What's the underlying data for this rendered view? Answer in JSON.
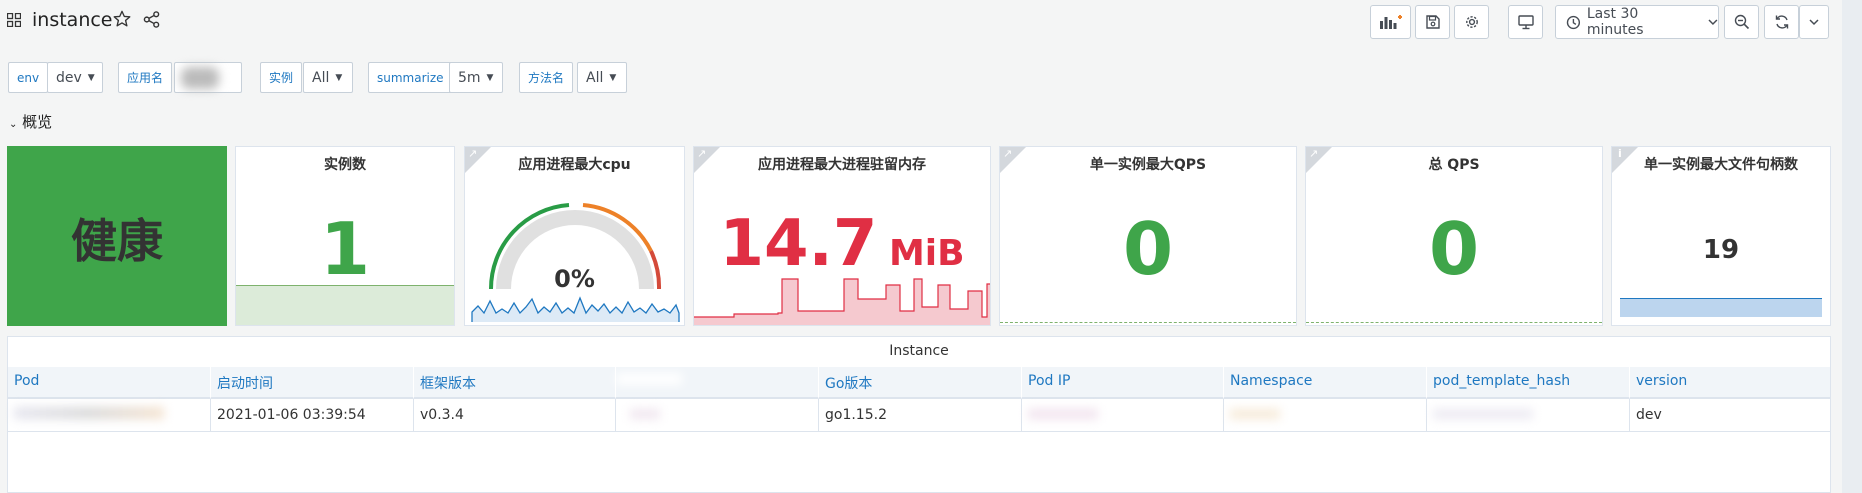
{
  "header": {
    "title": "instance",
    "time_range": "Last 30 minutes"
  },
  "variables": [
    {
      "label": "env",
      "value": "dev"
    },
    {
      "label": "应用名",
      "value": ""
    },
    {
      "label": "实例",
      "value": "All"
    },
    {
      "label": "summarize",
      "value": "5m"
    },
    {
      "label": "方法名",
      "value": "All"
    }
  ],
  "row": {
    "title": "概览"
  },
  "panels": {
    "health": {
      "text": "健康",
      "color": "#3fa54a"
    },
    "instances": {
      "title": "实例数",
      "value": "1",
      "color": "#3fa54a"
    },
    "cpu": {
      "title": "应用进程最大cpu",
      "value": "0%",
      "gauge_fraction": 0
    },
    "memory": {
      "title": "应用进程最大进程驻留内存",
      "value": "14.7",
      "unit": "MiB",
      "color": "#e02f44"
    },
    "max_qps": {
      "title": "单一实例最大QPS",
      "value": "0",
      "color": "#3fa54a"
    },
    "total_qps": {
      "title": "总 QPS",
      "value": "0",
      "color": "#3fa54a"
    },
    "max_fd": {
      "title": "单一实例最大文件句柄数",
      "value": "19",
      "info_glyph": "i"
    }
  },
  "table": {
    "title": "Instance",
    "columns": [
      "Pod",
      "启动时间",
      "框架版本",
      "",
      "Go版本",
      "Pod IP",
      "Namespace",
      "pod_template_hash",
      "version"
    ],
    "rows": [
      [
        "",
        "2021-01-06 03:39:54",
        "v0.3.4",
        "",
        "go1.15.2",
        "",
        "",
        "",
        "dev"
      ]
    ]
  },
  "colors": {
    "accent_blue": "#1f78c1",
    "health_green": "#3fa54a",
    "memory_red": "#e02f44",
    "gauge_green": "#299c46",
    "gauge_orange": "#ed8128",
    "gauge_red": "#d44a3a"
  }
}
